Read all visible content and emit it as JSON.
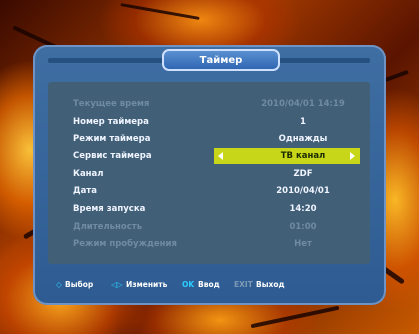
{
  "title": "Таймер",
  "rows": [
    {
      "label": "Текущее время",
      "value": "2010/04/01 14:19"
    },
    {
      "label": "Номер таймера",
      "value": "1"
    },
    {
      "label": "Режим таймера",
      "value": "Однажды"
    },
    {
      "label": "Сервис таймера",
      "value": "ТВ канал"
    },
    {
      "label": "Канал",
      "value": "ZDF"
    },
    {
      "label": "Дата",
      "value": "2010/04/01"
    },
    {
      "label": "Время запуска",
      "value": "14:20"
    },
    {
      "label": "Длительность",
      "value": "01:00"
    },
    {
      "label": "Режим пробуждения",
      "value": "Нет"
    }
  ],
  "footer": {
    "select_icon": "◇",
    "select_label": "Выбор",
    "change_icon": "◁▷",
    "change_label": "Изменить",
    "ok_key": "OK",
    "ok_label": "Ввод",
    "exit_key": "EXIT",
    "exit_label": "Выход"
  }
}
